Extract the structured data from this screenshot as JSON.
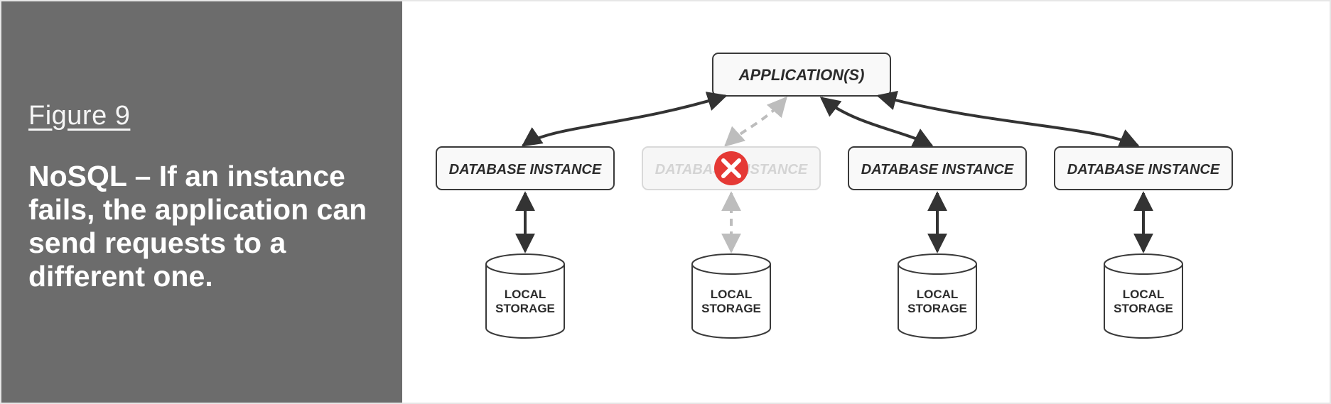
{
  "left": {
    "figure_label": "Figure 9",
    "headline": "NoSQL – If an instance fails, the application can send requests to a different one."
  },
  "diagram": {
    "app_box": "APPLICATION(S)",
    "db_instance_label": "DATABASE INSTANCE",
    "db_instance_failed_label": "DATABASE INSTANCE",
    "storage_line1": "LOCAL",
    "storage_line2": "STORAGE",
    "failed_icon": "error-x"
  }
}
